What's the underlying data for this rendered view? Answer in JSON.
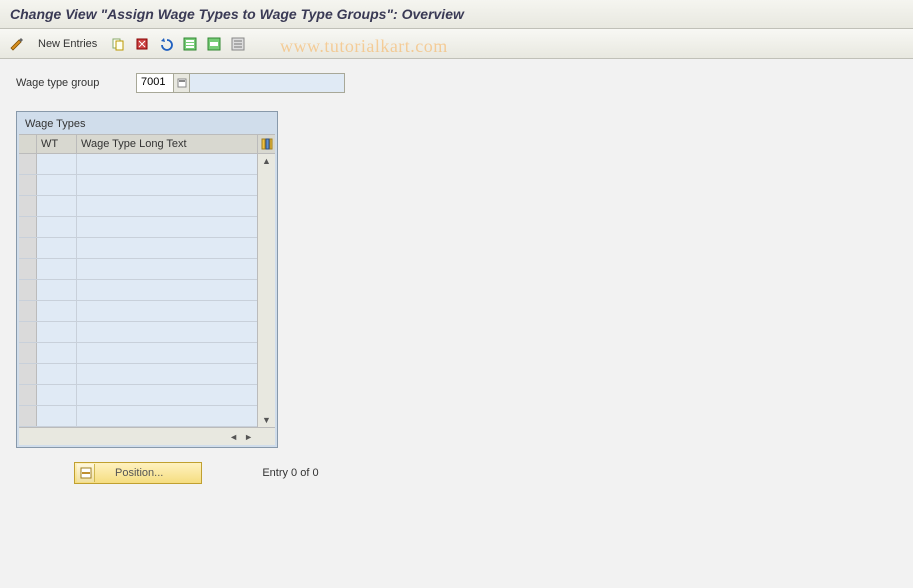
{
  "title": "Change View \"Assign Wage Types to Wage Type Groups\": Overview",
  "toolbar": {
    "new_entries_label": "New Entries"
  },
  "watermark": "www.tutorialkart.com",
  "field": {
    "label": "Wage type group",
    "value": "7001",
    "desc": ""
  },
  "table": {
    "title": "Wage Types",
    "col_wt": "WT",
    "col_long": "Wage Type Long Text",
    "row_count": 13
  },
  "footer": {
    "position_label": "Position...",
    "entry_text": "Entry 0 of 0"
  }
}
